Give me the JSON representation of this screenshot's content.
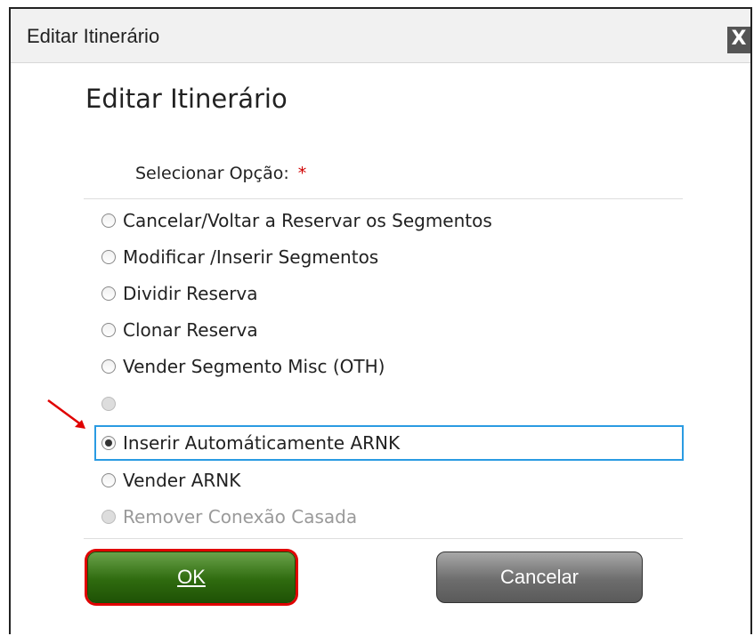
{
  "window": {
    "title": "Editar Itinerário",
    "close_glyph": "X"
  },
  "dialog": {
    "heading": "Editar Itinerário",
    "select_label": "Selecionar Opção:",
    "required_mark": "*"
  },
  "options": [
    {
      "label": "Cancelar/Voltar a Reservar os Segmentos",
      "checked": false,
      "disabled": false
    },
    {
      "label": "Modificar /Inserir Segmentos",
      "checked": false,
      "disabled": false
    },
    {
      "label": "Dividir  Reserva",
      "checked": false,
      "disabled": false
    },
    {
      "label": "Clonar Reserva",
      "checked": false,
      "disabled": false
    },
    {
      "label": "Vender Segmento Misc (OTH)",
      "checked": false,
      "disabled": false
    },
    {
      "label": "",
      "checked": false,
      "disabled": true
    },
    {
      "label": "Inserir Automáticamente ARNK",
      "checked": true,
      "disabled": false
    },
    {
      "label": "Vender ARNK",
      "checked": false,
      "disabled": false
    },
    {
      "label": "Remover Conexão Casada",
      "checked": false,
      "disabled": true
    }
  ],
  "buttons": {
    "ok_label": "OK",
    "cancel_label": "Cancelar"
  },
  "colors": {
    "ok_green": "#2f6b0f",
    "highlight_red": "#e00000",
    "selection_blue": "#2a9be2"
  },
  "icons": {
    "close": "close-icon",
    "annotation_arrow": "red-arrow-icon"
  }
}
